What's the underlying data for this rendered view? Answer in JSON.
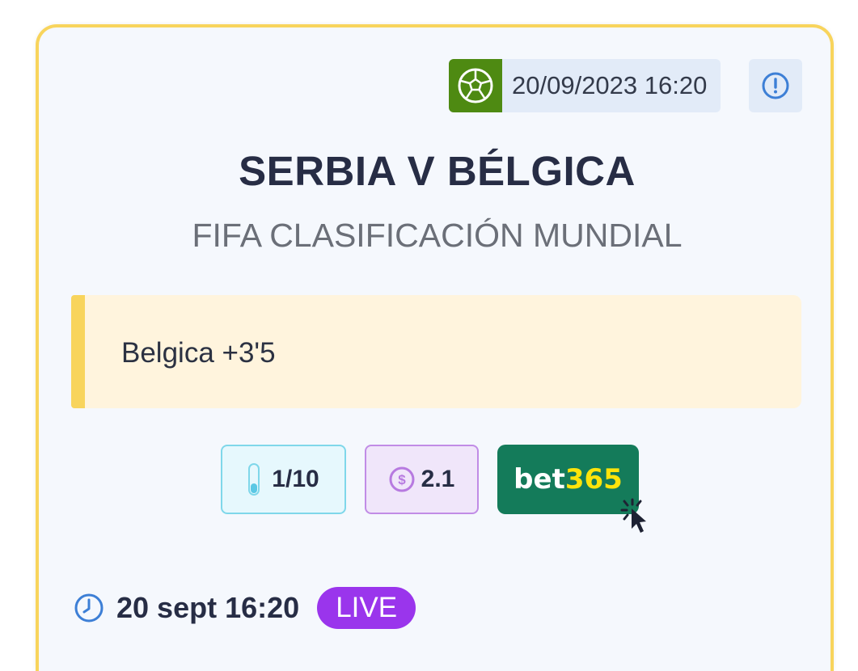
{
  "header": {
    "sport_icon": "soccer-ball-icon",
    "datetime": "20/09/2023 16:20",
    "info_icon": "exclamation-circle-icon"
  },
  "match": {
    "title": "SERBIA V BÉLGICA",
    "competition": "FIFA CLASIFICACIÓN MUNDIAL"
  },
  "pick": {
    "text": "Belgica +3'5"
  },
  "stats": {
    "stake_icon": "thermometer-icon",
    "stake": "1/10",
    "odds_icon": "dollar-coin-icon",
    "odds": "2.1"
  },
  "bookmaker": {
    "name_part1": "bet",
    "name_part2": "365",
    "cursor_icon": "click-cursor-icon"
  },
  "footer": {
    "clock_icon": "clock-icon",
    "time": "20 sept 16:20",
    "live_label": "LIVE"
  },
  "colors": {
    "card_border": "#f8d45c",
    "ball_bg": "#4e8a12",
    "bet365_green": "#147b5a",
    "bet365_yellow": "#ffe40a",
    "live_purple": "#9a35ec"
  }
}
